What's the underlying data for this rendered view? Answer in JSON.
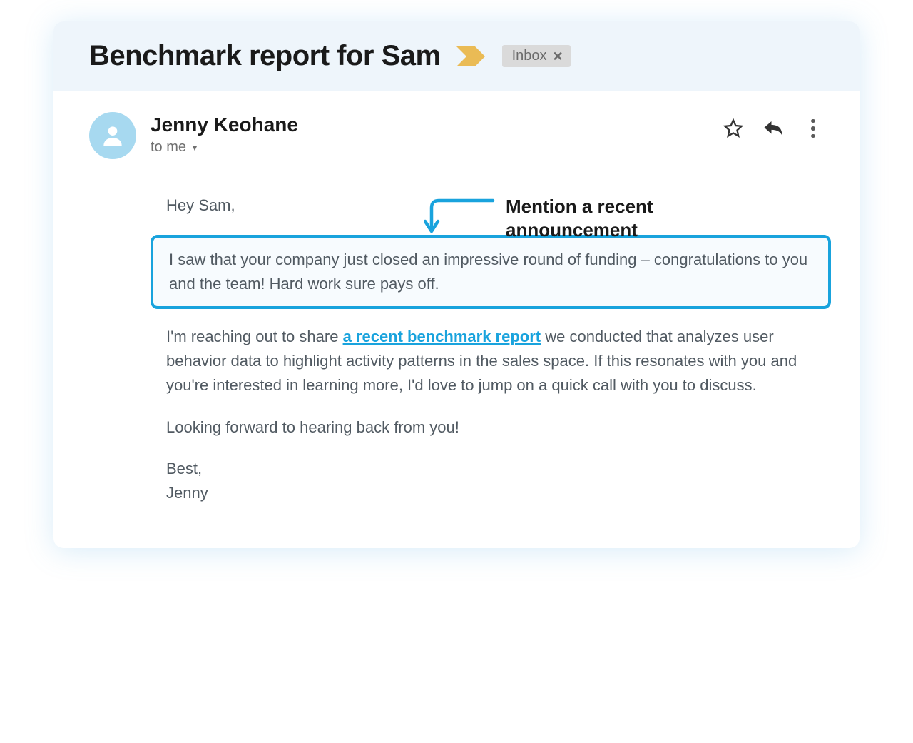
{
  "header": {
    "subject": "Benchmark report for Sam",
    "inbox_label": "Inbox"
  },
  "sender": {
    "name": "Jenny Keohane",
    "recipient_text": "to me"
  },
  "annotation": {
    "label": "Mention a recent announcement"
  },
  "body": {
    "greeting": "Hey Sam,",
    "highlighted": "I saw that your company just closed an impressive round of funding – congratulations to you and the team! Hard work sure pays off.",
    "p2_pre": "I'm reaching out to share ",
    "p2_link": "a recent benchmark report",
    "p2_post": " we conducted that analyzes user behavior data to highlight activity patterns in the sales space. If this resonates with you and you're interested in learning more, I'd love to jump on a quick call with you to discuss.",
    "p3": "Looking forward to hearing back from you!",
    "signoff1": "Best,",
    "signoff2": "Jenny"
  }
}
